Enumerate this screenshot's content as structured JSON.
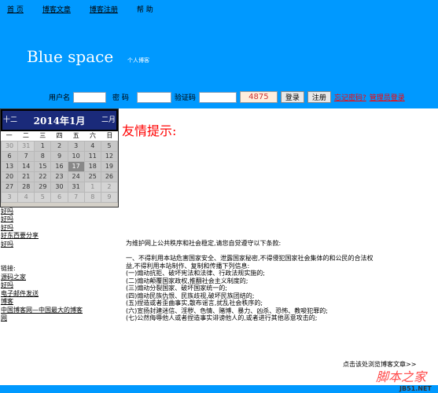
{
  "nav": {
    "items": [
      {
        "label": "首 页",
        "link": true
      },
      {
        "label": "博客文章",
        "link": true
      },
      {
        "label": "博客注册",
        "link": true
      },
      {
        "label": "帮 助",
        "link": false
      }
    ]
  },
  "header": {
    "title": "Blue space",
    "subtitle": "个人博客"
  },
  "login": {
    "username_label": "用户名",
    "password_label": "密 码",
    "captcha_label": "验证码",
    "captcha_code": "4875",
    "login_button": "登录",
    "register_button": "注册",
    "forgot_link": "忘记密码?",
    "admin_link": "管理员登录"
  },
  "calendar": {
    "prev": "十二",
    "title": "2014年1月",
    "next": "二月",
    "weekdays": [
      "一",
      "二",
      "三",
      "四",
      "五",
      "六",
      "日"
    ],
    "days": [
      {
        "d": "30",
        "out": true
      },
      {
        "d": "31",
        "out": true
      },
      {
        "d": "1"
      },
      {
        "d": "2"
      },
      {
        "d": "3"
      },
      {
        "d": "4"
      },
      {
        "d": "5"
      },
      {
        "d": "6"
      },
      {
        "d": "7"
      },
      {
        "d": "8"
      },
      {
        "d": "9"
      },
      {
        "d": "10"
      },
      {
        "d": "11"
      },
      {
        "d": "12"
      },
      {
        "d": "13"
      },
      {
        "d": "14"
      },
      {
        "d": "15"
      },
      {
        "d": "16"
      },
      {
        "d": "17",
        "today": true
      },
      {
        "d": "18"
      },
      {
        "d": "19"
      },
      {
        "d": "20"
      },
      {
        "d": "21"
      },
      {
        "d": "22"
      },
      {
        "d": "23"
      },
      {
        "d": "24"
      },
      {
        "d": "25"
      },
      {
        "d": "26"
      },
      {
        "d": "27"
      },
      {
        "d": "28"
      },
      {
        "d": "29"
      },
      {
        "d": "30"
      },
      {
        "d": "31"
      },
      {
        "d": "1",
        "out": true
      },
      {
        "d": "2",
        "out": true
      },
      {
        "d": "3",
        "out": true
      },
      {
        "d": "4",
        "out": true
      },
      {
        "d": "5",
        "out": true
      },
      {
        "d": "6",
        "out": true
      },
      {
        "d": "7",
        "out": true
      },
      {
        "d": "8",
        "out": true
      },
      {
        "d": "9",
        "out": true
      }
    ]
  },
  "left": {
    "articles": [
      "好吗",
      "好吗",
      "好吗",
      "好东西要分享",
      "好吗"
    ],
    "links_label": "链接:",
    "links": [
      "源码之家",
      "好吗",
      "电子邮件发送",
      "博客",
      "中国博客网—中国最大的博客网"
    ]
  },
  "notice": {
    "title": "友情提示:",
    "lines": [
      "为维护网上公共秩序和社会稳定,请您自觉遵守以下条款:",
      "",
      "一、不得利用本站危害国家安全、泄露国家秘密,不得侵犯国家社会集体的和公民的合法权益,不得利用本站制作、复制和传播下列信息:",
      "(一)煽动抗拒、破坏宪法和法律、行政法规实施的;",
      "(二)煽动颠覆国家政权,推翻社会主义制度的;",
      "(三)煽动分裂国家、破坏国家统一的;",
      "(四)煽动民族仇恨、民族歧视,破坏民族团结的;",
      "(五)捏造或者歪曲事实,散布谣言,扰乱社会秩序的;",
      "(六)宣扬封建迷信、淫秽、色情、赌博、暴力、凶杀、恐怖、教唆犯罪的;",
      "(七)公然侮辱他人或者捏造事实诽谤他人的,或者进行其他恶意攻击的;"
    ]
  },
  "more_link": "点击该处浏览博客文章>>",
  "watermark": {
    "main": "脚本之家",
    "sub": "JB51.NET"
  }
}
